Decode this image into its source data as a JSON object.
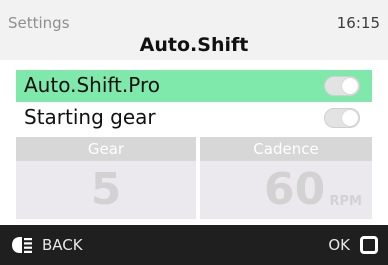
{
  "header": {
    "left_label": "Settings",
    "time": "16:15",
    "title": "Auto.Shift"
  },
  "settings": [
    {
      "label": "Auto.Shift.Pro",
      "enabled": false,
      "selected": true
    },
    {
      "label": "Starting gear",
      "enabled": false,
      "selected": false
    }
  ],
  "tiles": {
    "gear": {
      "caption": "Gear",
      "value": "5"
    },
    "cadence": {
      "caption": "Cadence",
      "value": "60",
      "unit": "RPM"
    }
  },
  "footer": {
    "back_label": "BACK",
    "ok_label": "OK"
  },
  "colors": {
    "selected_row": "#7fe8ab",
    "footer_bg": "#1f1f1f"
  }
}
